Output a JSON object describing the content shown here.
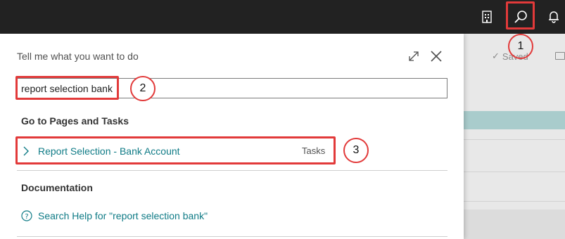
{
  "topbar": {
    "icons": [
      "document-icon",
      "search-icon",
      "bell-icon"
    ]
  },
  "background_page": {
    "saved_label": "Saved"
  },
  "panel": {
    "title": "Tell me what you want to do",
    "search": {
      "value": "report selection bank"
    },
    "pages_section_title": "Go to Pages and Tasks",
    "results": [
      {
        "label": "Report Selection - Bank Account",
        "category": "Tasks"
      }
    ],
    "documentation_title": "Documentation",
    "help_link": "Search Help for \"report selection bank\""
  },
  "callouts": {
    "one": "1",
    "two": "2",
    "three": "3"
  },
  "colors": {
    "topbar_bg": "#222222",
    "link": "#0f7b86",
    "highlight": "#e23a3a",
    "teal_row": "#a9cccc"
  }
}
